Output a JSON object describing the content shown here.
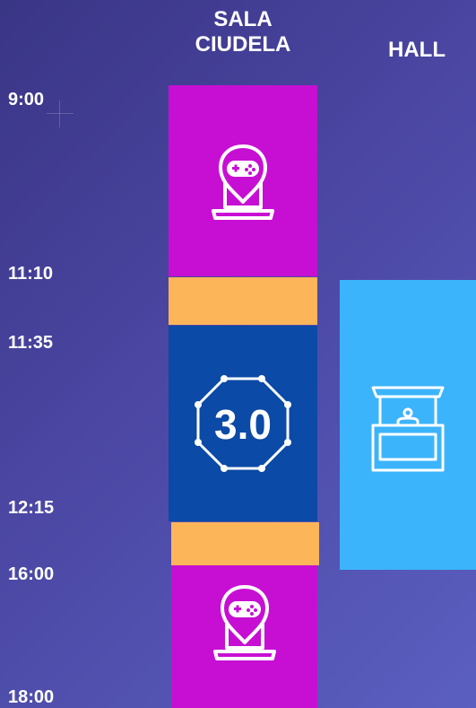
{
  "columns": {
    "sala": "SALA\nCIUDELA",
    "hall": "HALL"
  },
  "times": [
    "9:00",
    "11:10",
    "11:35",
    "12:15",
    "16:00",
    "18:00"
  ],
  "blocks": {
    "gaming_1": {
      "color": "#c70fd3",
      "icon": "gamepad-laptop-icon"
    },
    "break_1": {
      "color": "#fdb55a"
    },
    "talk_30": {
      "color": "#0b4aa6",
      "icon": "octagon-3.0-icon",
      "label": "3.0"
    },
    "break_2": {
      "color": "#fdb55a"
    },
    "gaming_2": {
      "color": "#c70fd3",
      "icon": "gamepad-laptop-icon"
    },
    "hall_stand": {
      "color": "#3cb4fb",
      "icon": "booth-stand-icon"
    }
  }
}
